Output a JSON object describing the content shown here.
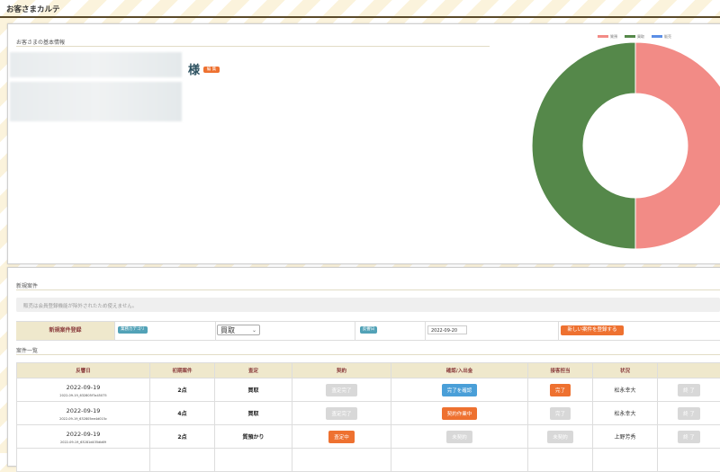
{
  "app": {
    "title": "お客さまカルテ"
  },
  "basic_info": {
    "heading": "お客さまの基本情報",
    "honorific": "様",
    "edit_label": "編 集"
  },
  "donut": {
    "legend": [
      {
        "name": "質預",
        "color": "#f28b86"
      },
      {
        "name": "買取",
        "color": "#55884a"
      },
      {
        "name": "販売",
        "color": "#5b8fe6"
      }
    ]
  },
  "chart_data": {
    "type": "pie",
    "categories": [
      "質預",
      "買取",
      "販売"
    ],
    "values": [
      50,
      50,
      0
    ],
    "colors": [
      "#f28b86",
      "#55884a",
      "#5b8fe6"
    ],
    "donut": true,
    "legend_position": "top-right"
  },
  "new_case": {
    "heading": "新規案件",
    "notice": "販売は会員登録機能が除外されたため使えません。",
    "register_label": "新規案件登録",
    "category_badge": "業務カテゴリ",
    "category_value": "買取",
    "date_badge": "反響日",
    "date_value": "2022-09-20",
    "submit_label": "新しい案件を登録する"
  },
  "case_list": {
    "heading": "案件一覧",
    "columns": [
      "反響日",
      "初期案件",
      "査定",
      "契約",
      "確認/入出金",
      "接客担当",
      "状況",
      ""
    ],
    "rows": [
      {
        "date": "2022-09-19",
        "sub": "2022-09-19_632805f7a45075",
        "points": "2点",
        "assess": "買取",
        "contract": "査定完了",
        "contract_style": "gray",
        "confirm": "完了を確認",
        "confirm_style": "blue",
        "staff": "完了",
        "staff_style": "orange",
        "status": "松永幸大",
        "action": "終 了"
      },
      {
        "date": "2022-09-19",
        "sub": "2022-09-19_632805ee4d015c",
        "points": "4点",
        "assess": "買取",
        "contract": "査定完了",
        "contract_style": "gray",
        "confirm": "契約作業中",
        "confirm_style": "orange",
        "staff": "完了",
        "staff_style": "gray",
        "status": "松永幸大",
        "action": "終 了"
      },
      {
        "date": "2022-09-19",
        "sub": "2022-09-19_63281d435db69",
        "points": "2点",
        "assess": "質預かり",
        "contract": "査定中",
        "contract_style": "orange",
        "confirm": "未契約",
        "confirm_style": "gray",
        "staff": "未契約",
        "staff_style": "gray",
        "status": "上野芳秀",
        "action": "終 了"
      }
    ]
  }
}
